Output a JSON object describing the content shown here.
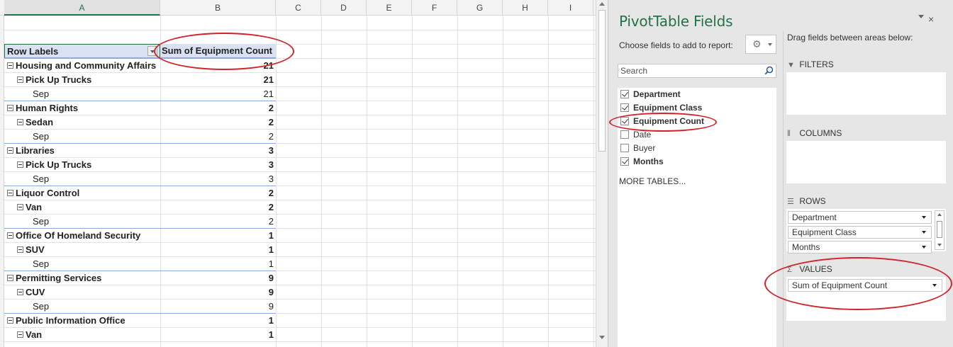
{
  "spreadsheet": {
    "columns": [
      "A",
      "B",
      "C",
      "D",
      "E",
      "F",
      "G",
      "H",
      "I"
    ],
    "pivot_header": {
      "row_labels": "Row Labels",
      "value_header": "Sum of Equipment Count"
    },
    "rows": [
      {
        "label": "Housing and Community Affairs",
        "value": "21",
        "level": 0
      },
      {
        "label": "Pick Up Trucks",
        "value": "21",
        "level": 1
      },
      {
        "label": "Sep",
        "value": "21",
        "level": 2
      },
      {
        "label": "Human Rights",
        "value": "2",
        "level": 0
      },
      {
        "label": "Sedan",
        "value": "2",
        "level": 1
      },
      {
        "label": "Sep",
        "value": "2",
        "level": 2
      },
      {
        "label": "Libraries",
        "value": "3",
        "level": 0
      },
      {
        "label": "Pick Up Trucks",
        "value": "3",
        "level": 1
      },
      {
        "label": "Sep",
        "value": "3",
        "level": 2
      },
      {
        "label": "Liquor Control",
        "value": "2",
        "level": 0
      },
      {
        "label": "Van",
        "value": "2",
        "level": 1
      },
      {
        "label": "Sep",
        "value": "2",
        "level": 2
      },
      {
        "label": "Office Of Homeland Security",
        "value": "1",
        "level": 0
      },
      {
        "label": "SUV",
        "value": "1",
        "level": 1
      },
      {
        "label": "Sep",
        "value": "1",
        "level": 2
      },
      {
        "label": "Permitting Services",
        "value": "9",
        "level": 0
      },
      {
        "label": "CUV",
        "value": "9",
        "level": 1
      },
      {
        "label": "Sep",
        "value": "9",
        "level": 2
      },
      {
        "label": "Public Information Office",
        "value": "1",
        "level": 0
      },
      {
        "label": "Van",
        "value": "1",
        "level": 1
      }
    ]
  },
  "pivot_pane": {
    "title": "PivotTable Fields",
    "close_glyph": "×",
    "choose_label": "Choose fields to add to report:",
    "gear_icon": "gear-icon",
    "search_placeholder": "Search",
    "fields": [
      {
        "name": "Department",
        "checked": true
      },
      {
        "name": "Equipment Class",
        "checked": true
      },
      {
        "name": "Equipment Count",
        "checked": true
      },
      {
        "name": "Date",
        "checked": false
      },
      {
        "name": "Buyer",
        "checked": false
      },
      {
        "name": "Months",
        "checked": true
      }
    ],
    "more_tables": "MORE TABLES...",
    "drag_label": "Drag fields between areas below:",
    "areas": {
      "filters": {
        "label": "FILTERS",
        "icon": "filter-icon",
        "items": []
      },
      "columns": {
        "label": "COLUMNS",
        "icon": "columns-icon",
        "items": []
      },
      "rows": {
        "label": "ROWS",
        "icon": "rows-icon",
        "items": [
          "Department",
          "Equipment Class",
          "Months"
        ]
      },
      "values": {
        "label": "VALUES",
        "icon": "sigma-icon",
        "items": [
          "Sum of Equipment Count"
        ]
      }
    }
  },
  "colors": {
    "accent": "#217346",
    "pivot_header_fill": "#d9e1f2",
    "annotation": "#d2232a"
  }
}
